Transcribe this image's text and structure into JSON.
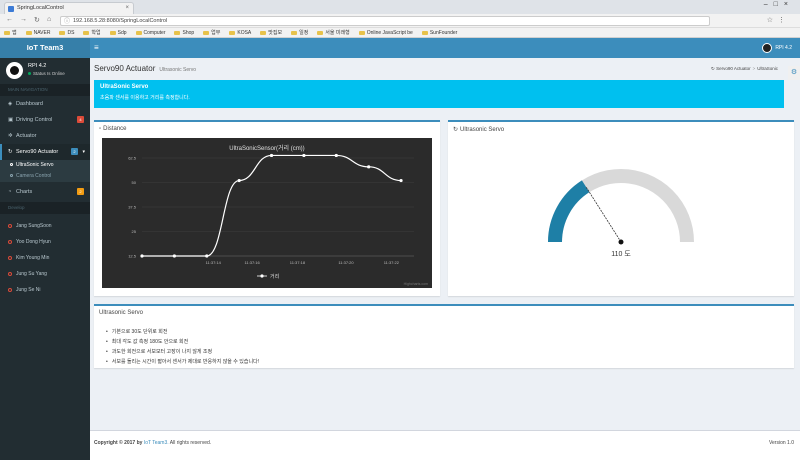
{
  "browser": {
    "tab_title": "SpringLocalControl",
    "url": "192.168.5.28:8080/SpringLocalControl",
    "bookmarks": [
      "앱",
      "NAVER",
      "DS",
      "학업",
      "Sdp",
      "Computer",
      "Shop",
      "업무",
      "KOSA",
      "맛집모",
      "일정",
      "서울 미래형",
      "Online JavaScript be",
      "SunFounder"
    ]
  },
  "header": {
    "logo": "IoT Team3",
    "menu_icon": "hamburger-icon",
    "user": "RPI 4.2"
  },
  "sidebar": {
    "user_name": "RPI 4.2",
    "user_status": "Status Is Online",
    "nav_header": "MAIN NAVIGATION",
    "items": [
      {
        "label": "Dashboard",
        "icon": "dashboard-icon",
        "badge": ""
      },
      {
        "label": "Driving Control",
        "icon": "car-icon",
        "badge": "4",
        "badge_color": "#dd4b39"
      },
      {
        "label": "Actuator",
        "icon": "cog-icon",
        "badge": ""
      },
      {
        "label": "Servo90 Actuator",
        "icon": "refresh-icon",
        "badge": "2",
        "badge_color": "#3c8dbc"
      },
      {
        "label": "Charts",
        "icon": "pie-chart-icon",
        "badge": "2",
        "badge_color": "#f39c12"
      }
    ],
    "subitems": [
      "UltraSonic Servo",
      "Camera Control"
    ],
    "members_header": "Develop",
    "members": [
      "Jang SungSoon",
      "Yoo Dong Hyun",
      "Kim Young Min",
      "Jung Su Yang",
      "Jung Se Ni"
    ]
  },
  "page": {
    "title": "Servo90 Actuator",
    "subtitle": "Ultrasonic Servo",
    "breadcrumb": [
      "Servo90 Actuator",
      "UltraSonic"
    ]
  },
  "callout": {
    "title": "UltraSonic Servo",
    "body": "초음파 센서를 이용하고 거리를 측정합니다."
  },
  "distance_box": {
    "title": "Distance",
    "chart_title": "UltraSonicSensor(거리 (cm))",
    "legend": "거리",
    "credit": "Highcharts.com"
  },
  "chart_data": {
    "type": "line",
    "title": "UltraSonicSensor(거리 (cm))",
    "x": [
      "11:37:14",
      "11:37:16",
      "11:37:18",
      "11:37:20",
      "11:37:22"
    ],
    "series": [
      {
        "name": "거리",
        "points": [
          {
            "t": 0,
            "y": 12.5
          },
          {
            "t": 1,
            "y": 12.5
          },
          {
            "t": 2,
            "y": 12.5
          },
          {
            "t": 3,
            "y": 51.0
          },
          {
            "t": 4,
            "y": 63.8
          },
          {
            "t": 5,
            "y": 63.8
          },
          {
            "t": 6,
            "y": 63.8
          },
          {
            "t": 7,
            "y": 58.0
          },
          {
            "t": 8,
            "y": 51.0
          }
        ]
      }
    ],
    "xlabels_at": [
      2.2,
      3.4,
      4.8,
      6.3,
      7.7
    ],
    "ytick_labels": [
      "12.5",
      "25",
      "37.5",
      "50",
      "62.5"
    ],
    "yticks": [
      12.5,
      25,
      37.5,
      50,
      62.5
    ],
    "ylim": [
      12.5,
      62.5
    ],
    "legend_position": "bottom-center",
    "line_color": "#ffffff",
    "background": "#2b2b2b"
  },
  "servo_box": {
    "title": "Ultrasonic Servo",
    "gauge_value": 110,
    "gauge_unit": "도",
    "gauge_label": "110 도",
    "gauge_min": 0,
    "gauge_max": 180,
    "gauge_color": "#1e7fa6",
    "gauge_track": "#d9d9d9"
  },
  "info_box": {
    "title": "Ultrasonic Servo",
    "items": [
      "기본으로 30도 단위로 회전",
      "최대 각도 값 측정 180도 안으로 회전",
      "과도한 회전으로 서보모터 고장이 나지 않게 조정",
      "서보를 돌리는 시간이 짧아서 센서가 제대로 반응하지 않을 수 있습니다!"
    ]
  },
  "footer": {
    "copyright": "Copyright © 2017 by",
    "brand": "IoT Team3.",
    "rights": "All rights reserved.",
    "version": "Version 1.0"
  },
  "colors": {
    "header": "#3c8dbc",
    "sidebar": "#222d32",
    "callout": "#00c0ef"
  }
}
